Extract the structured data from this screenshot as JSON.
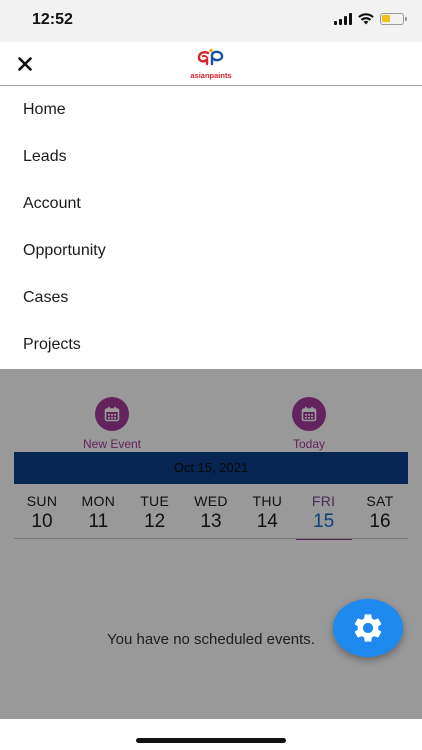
{
  "status_bar": {
    "time": "12:52"
  },
  "header": {
    "logo_text": "asianpaints"
  },
  "menu": {
    "items": [
      {
        "label": "Home"
      },
      {
        "label": "Leads"
      },
      {
        "label": "Account"
      },
      {
        "label": "Opportunity"
      },
      {
        "label": "Cases"
      },
      {
        "label": "Projects"
      }
    ]
  },
  "calendar": {
    "new_event_label": "New Event",
    "today_label": "Today",
    "current_date": "Oct 15, 2021",
    "days": [
      {
        "dow": "SUN",
        "num": "10"
      },
      {
        "dow": "MON",
        "num": "11"
      },
      {
        "dow": "TUE",
        "num": "12"
      },
      {
        "dow": "WED",
        "num": "13"
      },
      {
        "dow": "THU",
        "num": "14"
      },
      {
        "dow": "FRI",
        "num": "15"
      },
      {
        "dow": "SAT",
        "num": "16"
      }
    ],
    "selected_day": "FRI",
    "empty_message": "You have no scheduled events."
  },
  "colors": {
    "accent_purple": "#a53b9a",
    "date_bar": "#0b3f8a",
    "fab_blue": "#1e8af0",
    "brand_red": "#d6232a"
  },
  "icons": {
    "close": "close-icon",
    "calendar": "calendar-icon",
    "settings": "gear-icon"
  }
}
